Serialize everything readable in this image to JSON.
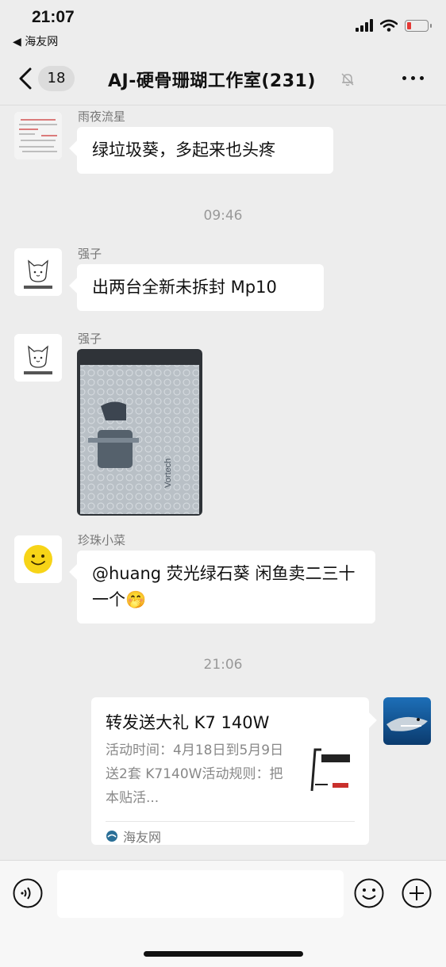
{
  "status_bar": {
    "time": "21:07",
    "back_app": "◀ 海友网"
  },
  "nav": {
    "unread_count": "18",
    "title": "AJ-硬骨珊瑚工作室(231)",
    "more_icon": "more-icon",
    "mute_icon": "bell-off-icon"
  },
  "messages": [
    {
      "sender": "雨夜流星",
      "text": "绿垃圾葵，多起来也头疼"
    },
    {
      "timestamp": "09:46"
    },
    {
      "sender": "强子",
      "text": "出两台全新未拆封 Mp10"
    },
    {
      "sender": "强子",
      "image": "product-box-in-bubble-wrap"
    },
    {
      "sender": "珍珠小菜",
      "text": "@huang 荧光绿石葵 闲鱼卖二三十一个🤭"
    },
    {
      "timestamp": "21:06"
    }
  ],
  "link_card": {
    "title": "转发送大礼 K7 140W",
    "desc": "活动时间：4月18日到5月9日送2套 K7140W活动规则：把本贴活...",
    "source": "海友网"
  },
  "input_bar": {
    "voice_icon": "voice-icon",
    "emoji_icon": "emoji-icon",
    "plus_icon": "plus-icon"
  },
  "colors": {
    "background": "#ededed",
    "bubble": "#ffffff",
    "battery_low": "#e53935"
  }
}
